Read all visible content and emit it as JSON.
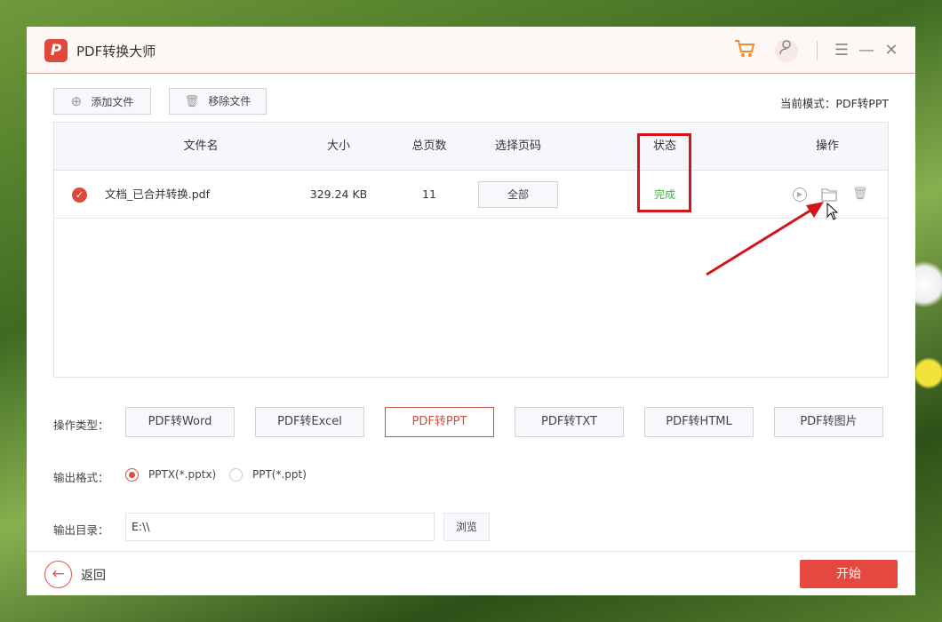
{
  "app": {
    "title": "PDF转换大师",
    "logo_letter": "P",
    "accent": "#e0483b"
  },
  "titlebar": {
    "icons": [
      "cart-icon",
      "user-icon",
      "menu-icon",
      "minimize-icon",
      "close-icon"
    ]
  },
  "toolbar": {
    "add_label": "添加文件",
    "remove_label": "移除文件",
    "mode_label": "当前模式：PDF转PPT"
  },
  "table": {
    "headers": [
      "文件名",
      "大小",
      "总页数",
      "选择页码",
      "状态",
      "操作"
    ],
    "rows": [
      {
        "checked": true,
        "name": "文档_已合并转换.pdf",
        "size": "329.24 KB",
        "pages": "11",
        "page_select": "全部",
        "status": "完成",
        "status_color": "#3cb340"
      }
    ]
  },
  "options": {
    "op_type_label": "操作类型：",
    "op_types": [
      "PDF转Word",
      "PDF转Excel",
      "PDF转PPT",
      "PDF转TXT",
      "PDF转HTML",
      "PDF转图片"
    ],
    "op_selected": "PDF转PPT",
    "format_label": "输出格式：",
    "formats": [
      "PPTX(*.pptx)",
      "PPT(*.ppt)"
    ],
    "format_selected": "PPTX(*.pptx)",
    "dir_label": "输出目录：",
    "dir_value": "E:\\\\",
    "browse_label": "浏览"
  },
  "footer": {
    "back_label": "返回",
    "start_label": "开始"
  }
}
